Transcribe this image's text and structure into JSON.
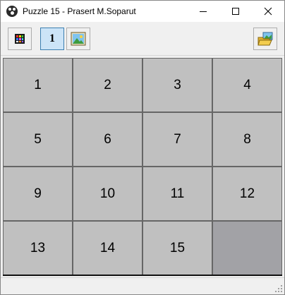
{
  "window": {
    "title": "Puzzle 15 - Prasert M.Soparut",
    "icon": "paw-icon",
    "controls": [
      "minimize",
      "maximize",
      "close"
    ]
  },
  "toolbar": {
    "buttons": [
      {
        "name": "color-palette-button",
        "icon": "color-grid-icon"
      },
      {
        "name": "number-mode-button",
        "label": "1",
        "active": true
      },
      {
        "name": "picture-mode-button",
        "icon": "picture-icon"
      },
      {
        "name": "open-image-button",
        "icon": "open-folder-image-icon"
      }
    ]
  },
  "board": {
    "tiles": [
      "1",
      "2",
      "3",
      "4",
      "5",
      "6",
      "7",
      "8",
      "9",
      "10",
      "11",
      "12",
      "13",
      "14",
      "15",
      ""
    ],
    "empty_index": 15
  },
  "colors": {
    "tile": "#c0c0c0",
    "empty_tile": "#a2a2a6",
    "grid_lines": "#666666",
    "active_button": "#cce4f7"
  },
  "statusbar": {
    "text": ""
  }
}
